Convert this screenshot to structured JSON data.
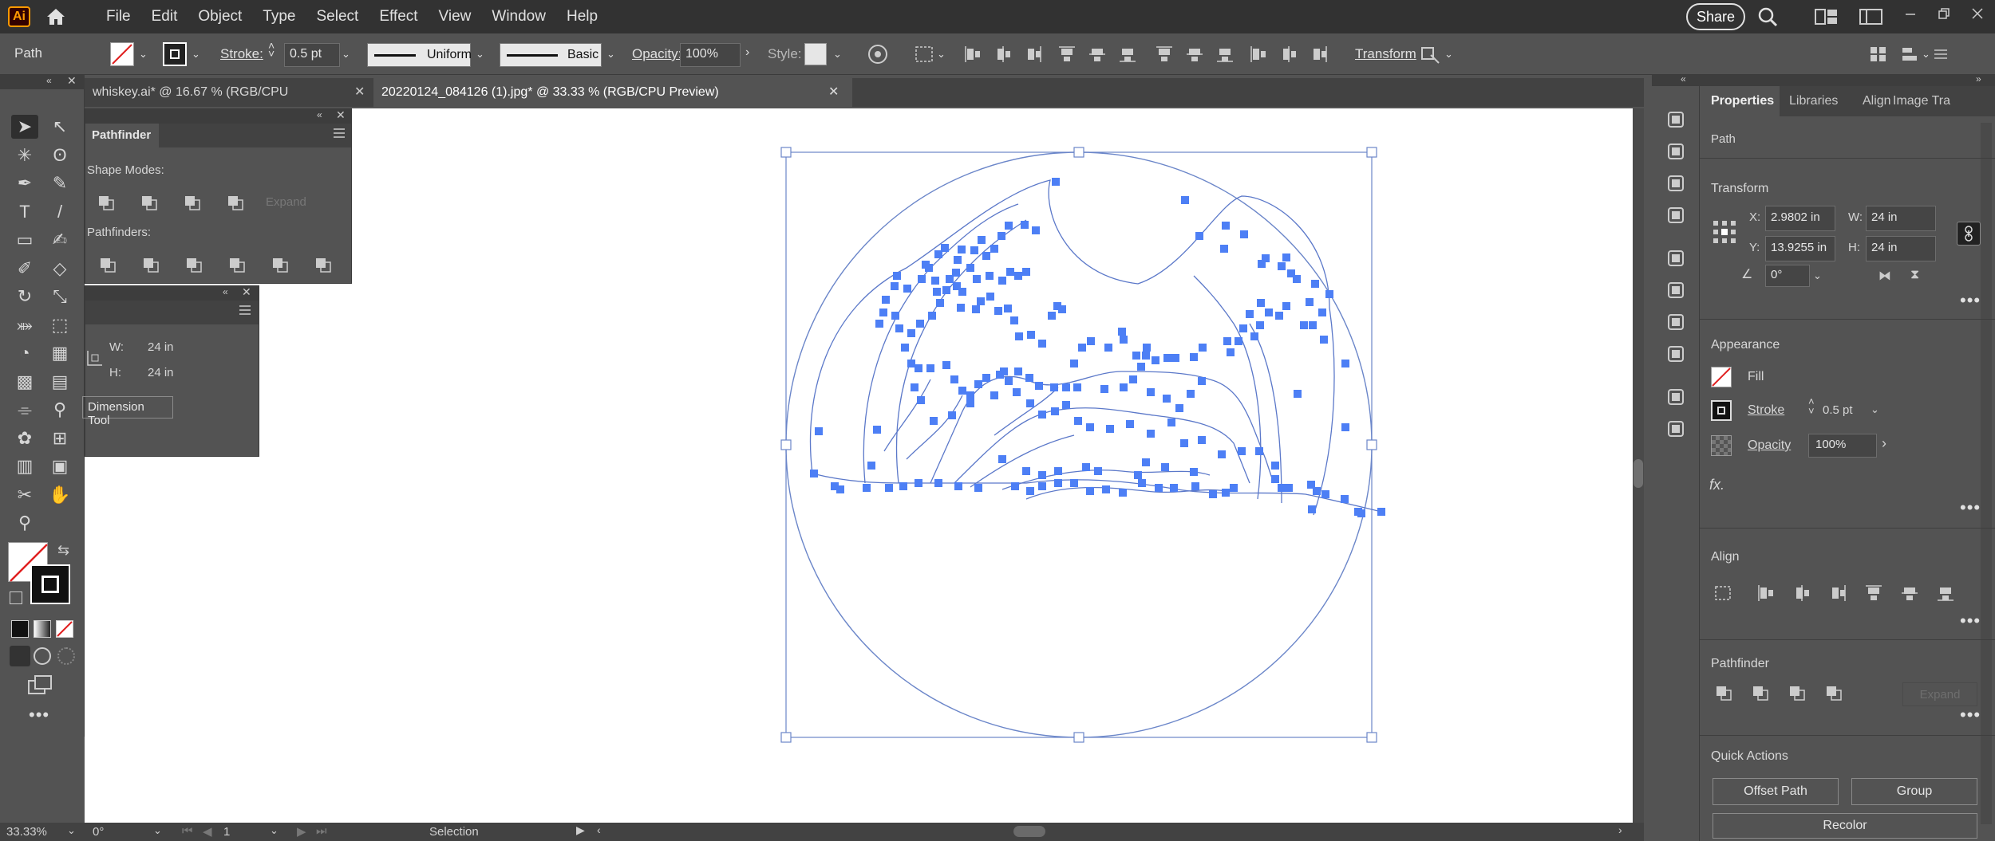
{
  "app": {
    "logo_text": "Ai"
  },
  "menu": [
    "File",
    "Edit",
    "Object",
    "Type",
    "Select",
    "Effect",
    "View",
    "Window",
    "Help"
  ],
  "share_label": "Share",
  "control": {
    "selection_type": "Path",
    "stroke_label": "Stroke:",
    "stroke_value": "0.5 pt",
    "profile": "Uniform",
    "brush": "Basic",
    "opacity_label": "Opacity:",
    "opacity_value": "100%",
    "style_label": "Style:",
    "transform_link": "Transform"
  },
  "tabs": [
    {
      "label": "whiskey.ai* @ 16.67 % (RGB/CPU Preview)"
    },
    {
      "label": "20220124_084126 (1).jpg* @ 33.33 % (RGB/CPU Preview)"
    }
  ],
  "pathfinder_panel": {
    "title": "Pathfinder",
    "shape_modes": "Shape Modes:",
    "pathfinders": "Pathfinders:",
    "expand": "Expand"
  },
  "dimension_panel": {
    "w_label": "W:",
    "w_value": "24 in",
    "h_label": "H:",
    "h_value": "24 in",
    "button": "Dimension Tool"
  },
  "properties": {
    "tabs": [
      "Properties",
      "Libraries",
      "Align",
      "Image Tra"
    ],
    "object_type": "Path",
    "transform": {
      "title": "Transform",
      "x_label": "X:",
      "x_value": "2.9802 in",
      "y_label": "Y:",
      "y_value": "13.9255 in",
      "w_label": "W:",
      "w_value": "24 in",
      "h_label": "H:",
      "h_value": "24 in",
      "angle_value": "0°"
    },
    "appearance": {
      "title": "Appearance",
      "fill_label": "Fill",
      "stroke_label": "Stroke",
      "stroke_value": "0.5 pt",
      "opacity_label": "Opacity",
      "opacity_value": "100%",
      "fx": "fx."
    },
    "align": {
      "title": "Align"
    },
    "pathfinder": {
      "title": "Pathfinder",
      "expand": "Expand"
    },
    "quick_actions": {
      "title": "Quick Actions",
      "offset_path": "Offset Path",
      "group": "Group",
      "recolor": "Recolor"
    }
  },
  "status": {
    "zoom": "33.33%",
    "angle": "0°",
    "artboard": "1",
    "tool": "Selection"
  },
  "colors": {
    "accent": "#4a7cf0",
    "anchor": "#4d7ff5",
    "path": "#5b78c9"
  }
}
